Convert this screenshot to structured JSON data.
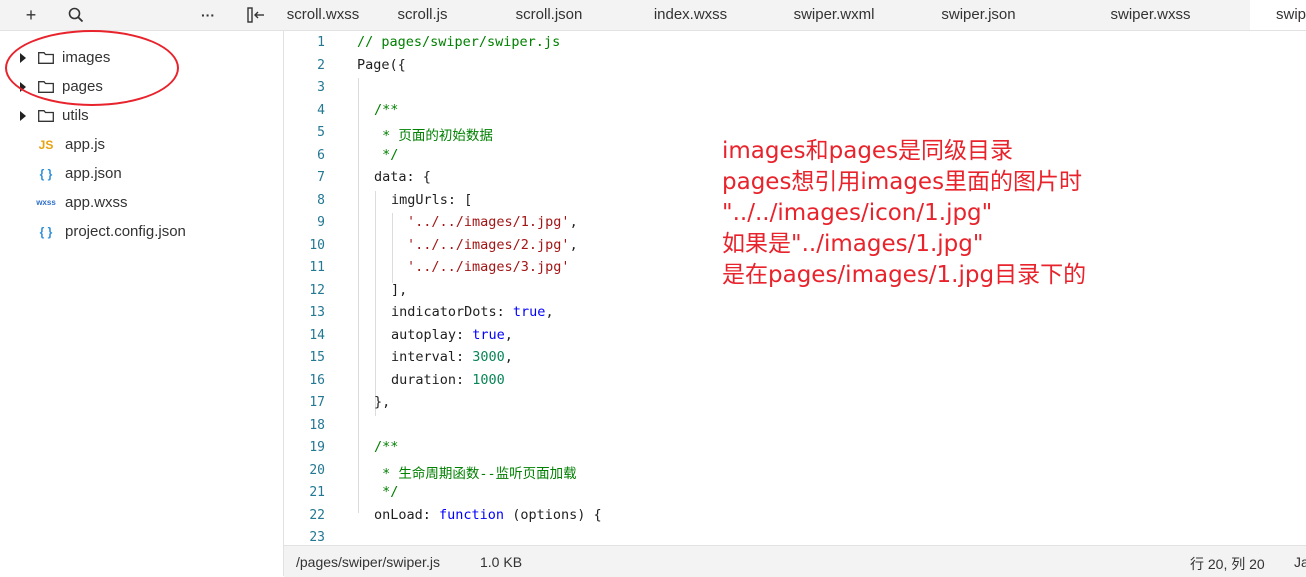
{
  "toolbar": {
    "add_icon": "plus-icon",
    "search_icon": "search-icon",
    "more_icon": "more-icon",
    "collapse_icon": "collapse-sidebar-icon",
    "add_glyph": "+",
    "more_glyph": "···",
    "collapse_glyph": "▯←"
  },
  "tabs": [
    {
      "label": "scroll.wxss"
    },
    {
      "label": "scroll.js"
    },
    {
      "label": "scroll.json"
    },
    {
      "label": "index.wxss"
    },
    {
      "label": "swiper.wxml"
    },
    {
      "label": "swiper.json"
    },
    {
      "label": "swiper.wxss"
    },
    {
      "label": "swiper.js",
      "active": true
    }
  ],
  "sidebar": {
    "items": [
      {
        "label": "images",
        "kind": "folder"
      },
      {
        "label": "pages",
        "kind": "folder"
      },
      {
        "label": "utils",
        "kind": "folder"
      },
      {
        "label": "app.js",
        "kind": "js",
        "badge": "JS"
      },
      {
        "label": "app.json",
        "kind": "json",
        "badge": "{ }"
      },
      {
        "label": "app.wxss",
        "kind": "wxss",
        "badge": "wxss"
      },
      {
        "label": "project.config.json",
        "kind": "json",
        "badge": "{ }"
      }
    ]
  },
  "editor": {
    "lines": [
      "1",
      "2",
      "3",
      "4",
      "5",
      "6",
      "7",
      "8",
      "9",
      "10",
      "11",
      "12",
      "13",
      "14",
      "15",
      "16",
      "17",
      "18",
      "19",
      "20",
      "21",
      "22",
      "23"
    ],
    "code": {
      "l1": "// pages/swiper/swiper.js",
      "l2": "Page({",
      "l4": "/**",
      "l5": " * 页面的初始数据",
      "l6": " */",
      "l7": "data: {",
      "l8": "imgUrls: [",
      "l9": "'../../images/1.jpg'",
      "l9_end": ",",
      "l10": "'../../images/2.jpg'",
      "l10_end": ",",
      "l11": "'../../images/3.jpg'",
      "l12": "],",
      "l13_key": "indicatorDots: ",
      "l13_val": "true",
      "l13_end": ",",
      "l14_key": "autoplay: ",
      "l14_val": "true",
      "l14_end": ",",
      "l15_key": "interval: ",
      "l15_val": "3000",
      "l15_end": ",",
      "l16_key": "duration: ",
      "l16_val": "1000",
      "l17": "},",
      "l19": "/**",
      "l20": " * 生命周期函数--监听页面加载",
      "l21": " */",
      "l22_key": "onLoad: ",
      "l22_kw": "function",
      "l22_rest": " (options) {"
    }
  },
  "annotation": {
    "lines": [
      "images和pages是同级目录",
      "pages想引用images里面的图片时",
      "\"../../images/icon/1.jpg\"",
      "如果是\"../images/1.jpg\"",
      "是在pages/images/1.jpg目录下的"
    ],
    "color": "#e8232c"
  },
  "status": {
    "path": "/pages/swiper/swiper.js",
    "size": "1.0 KB",
    "position": "行 20, 列 20",
    "language": "Ja"
  }
}
